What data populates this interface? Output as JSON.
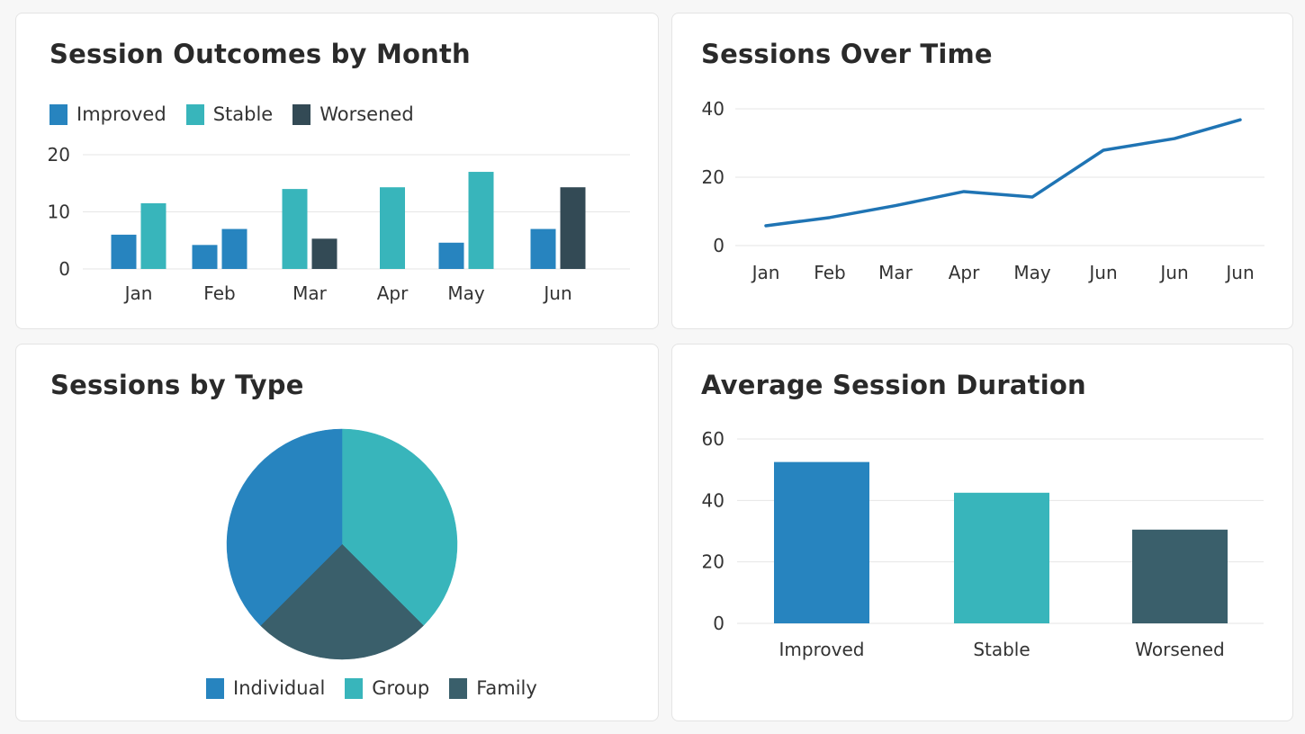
{
  "colors": {
    "improved": "#2784bf",
    "stable": "#38b5bb",
    "worsened": "#3a5f6b",
    "worsened_dark": "#334a55",
    "line": "#1f74b4",
    "grid": "#e6e6e6"
  },
  "panels": {
    "outcomes": {
      "title": "Session Outcomes by Month",
      "legend": [
        "Improved",
        "Stable",
        "Worsened"
      ],
      "chart_data": {
        "type": "bar",
        "title": "Session Outcomes by Month",
        "groups": [
          {
            "label": "Jan",
            "bars": [
              {
                "series": "Improved",
                "value": 6
              },
              {
                "series": "Stable",
                "value": 11.5
              }
            ]
          },
          {
            "label": "Feb",
            "bars": [
              {
                "series": "Improved",
                "value": 4.2
              },
              {
                "series": "Improved",
                "value": 7
              }
            ]
          },
          {
            "label": "Mar",
            "bars": [
              {
                "series": "Stable",
                "value": 14
              },
              {
                "series": "Worsened",
                "value": 5.3
              }
            ]
          },
          {
            "label": "Apr",
            "bars": [
              {
                "series": "Stable",
                "value": 14.3
              }
            ]
          },
          {
            "label": "May",
            "bars": [
              {
                "series": "Improved",
                "value": 4.6
              },
              {
                "series": "Stable",
                "value": 17
              }
            ]
          },
          {
            "label": "Jun",
            "bars": [
              {
                "series": "Improved",
                "value": 7
              },
              {
                "series": "Worsened",
                "value": 14.3
              }
            ]
          }
        ],
        "yticks": [
          0,
          10,
          20
        ],
        "ylim": [
          0,
          20
        ],
        "legend_position": "top-left",
        "grid": true
      }
    },
    "sessions_over_time": {
      "title": "Sessions Over Time",
      "chart_data": {
        "type": "line",
        "title": "Sessions Over Time",
        "categories": [
          "Jan",
          "Feb",
          "Mar",
          "Apr",
          "May",
          "Jun",
          "Jun",
          "Jun"
        ],
        "series": [
          {
            "values": [
              5.8,
              8.2,
              11.7,
              15.8,
              14.2,
              27.9,
              31.3,
              36.8
            ]
          }
        ],
        "yticks": [
          0,
          20,
          40
        ],
        "ylim": [
          0,
          40
        ],
        "grid": true
      }
    },
    "sessions_by_type": {
      "title": "Sessions by Type",
      "legend": [
        "Individual",
        "Group",
        "Family"
      ],
      "chart_data": {
        "type": "pie",
        "title": "Sessions by Type",
        "slices": [
          {
            "label": "Group",
            "value": 37.5
          },
          {
            "label": "Family",
            "value": 25
          },
          {
            "label": "Individual",
            "value": 37.5
          }
        ],
        "legend_position": "bottom"
      }
    },
    "avg_duration": {
      "title": "Average Session Duration",
      "chart_data": {
        "type": "bar",
        "title": "Average Session Duration",
        "categories": [
          "Improved",
          "Stable",
          "Worsened"
        ],
        "values": [
          52.5,
          42.5,
          30.5
        ],
        "yticks": [
          0,
          20,
          40,
          60
        ],
        "ylim": [
          0,
          60
        ],
        "grid": true
      }
    }
  }
}
